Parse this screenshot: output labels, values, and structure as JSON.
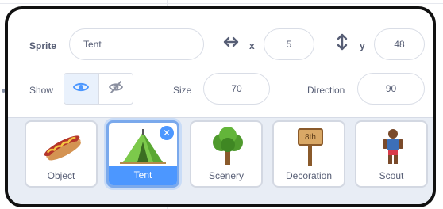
{
  "sprite_info": {
    "sprite_label": "Sprite",
    "sprite_name": "Tent",
    "x_label": "x",
    "x_value": "5",
    "y_label": "y",
    "y_value": "48",
    "show_label": "Show",
    "show_visible": true,
    "size_label": "Size",
    "size_value": "70",
    "direction_label": "Direction",
    "direction_value": "90",
    "icons": {
      "x": "horizontal-arrows-icon",
      "y": "vertical-arrows-icon",
      "show": "eye-icon",
      "hide": "eye-slash-icon"
    }
  },
  "sprites": [
    {
      "label": "Object",
      "icon": "hotdog-icon",
      "selected": false
    },
    {
      "label": "Tent",
      "icon": "tent-icon",
      "selected": true
    },
    {
      "label": "Scenery",
      "icon": "tree-icon",
      "selected": false
    },
    {
      "label": "Decoration",
      "icon": "signpost-icon",
      "selected": false,
      "sign_text": "8th"
    },
    {
      "label": "Scout",
      "icon": "scout-icon",
      "selected": false
    }
  ],
  "colors": {
    "accent": "#4c97ff",
    "text": "#575e75",
    "panel_border": "#111111"
  }
}
